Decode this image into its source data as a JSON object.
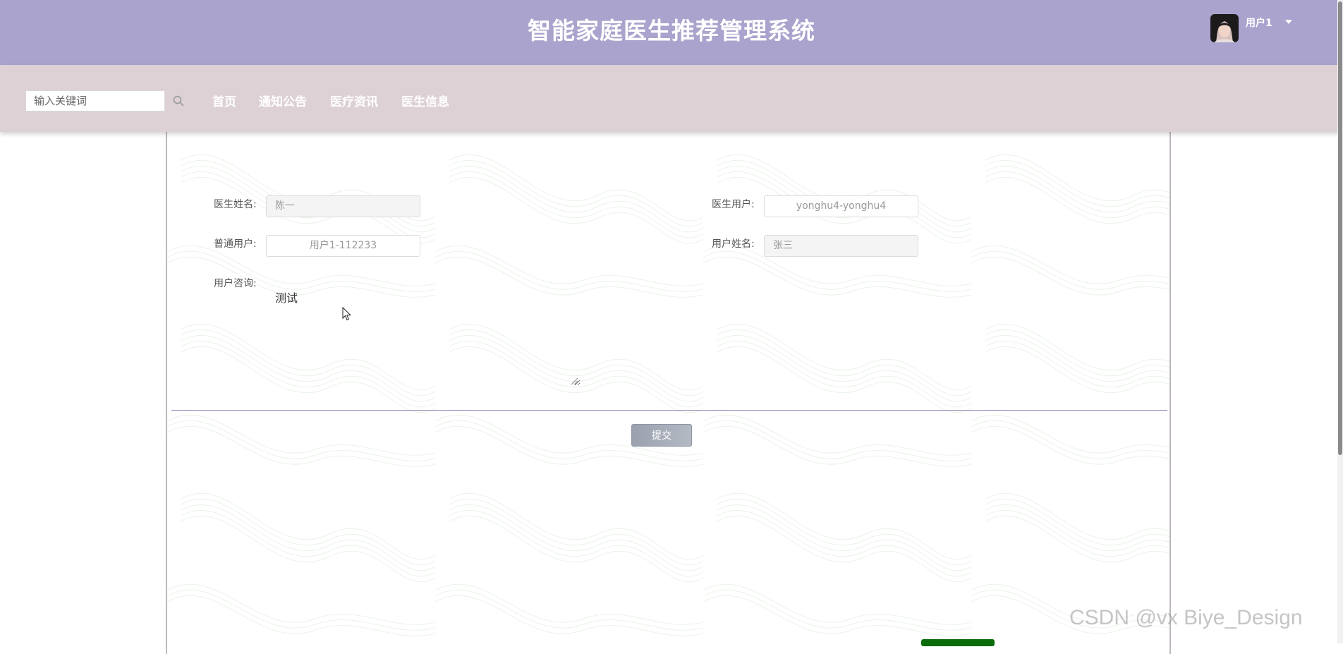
{
  "header": {
    "title": "智能家庭医生推荐管理系统",
    "user_name": "用户1",
    "avatar_icon": "avatar-photo",
    "background_color": "#a9a3cd"
  },
  "nav": {
    "search_placeholder": "输入关键词",
    "items": [
      {
        "label": "首页"
      },
      {
        "label": "通知公告"
      },
      {
        "label": "医疗资讯"
      },
      {
        "label": "医生信息"
      }
    ],
    "background_color": "#ddd1d6"
  },
  "form": {
    "doctor_name": {
      "label": "医生姓名:",
      "value": "陈一"
    },
    "doctor_user": {
      "label": "医生用户:",
      "value": "yonghu4-yonghu4"
    },
    "normal_user": {
      "label": "普通用户:",
      "value": "用户1-112233"
    },
    "user_name": {
      "label": "用户姓名:",
      "value": "张三"
    },
    "consultation": {
      "label": "用户咨询:",
      "value": "测试"
    },
    "submit_label": "提交"
  },
  "watermark": "CSDN @vx Biye_Design"
}
